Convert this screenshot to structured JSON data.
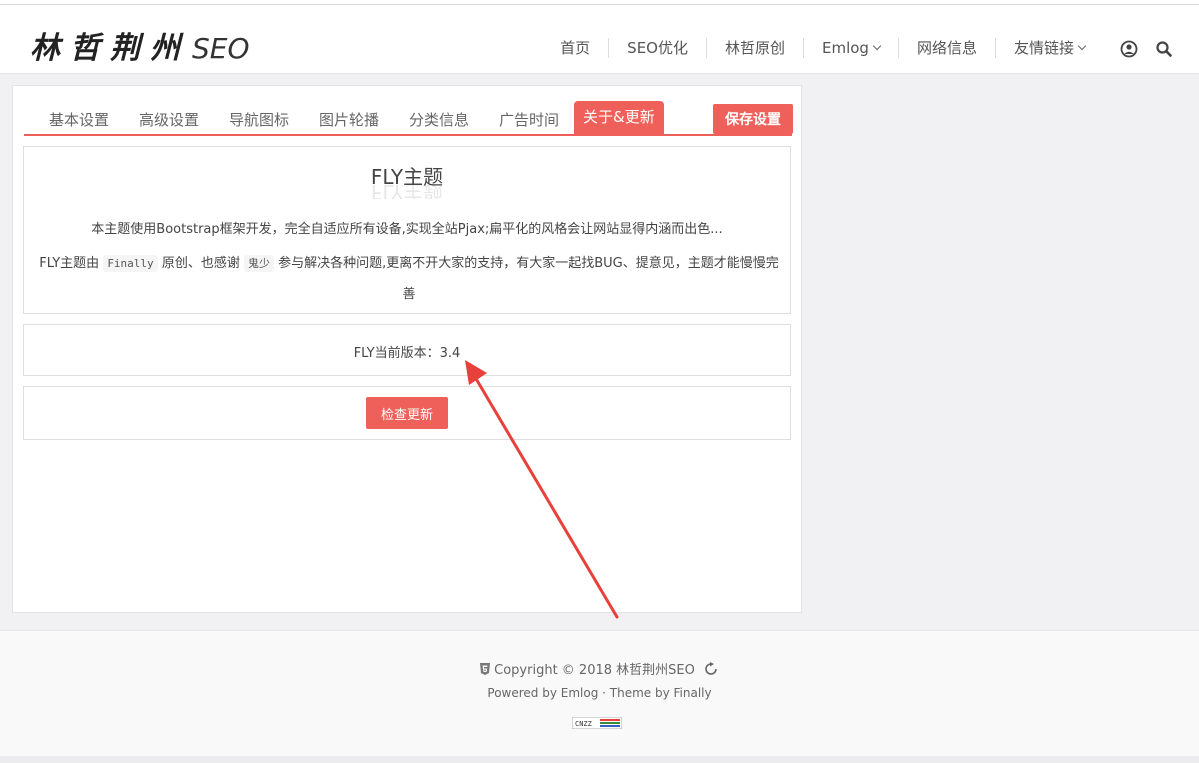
{
  "header": {
    "logo_cn": "林哲荆州",
    "logo_en": "SEO",
    "nav": [
      {
        "label": "首页",
        "dropdown": false
      },
      {
        "label": "SEO优化",
        "dropdown": false
      },
      {
        "label": "林哲原创",
        "dropdown": false
      },
      {
        "label": "Emlog",
        "dropdown": true
      },
      {
        "label": "网络信息",
        "dropdown": false
      },
      {
        "label": "友情链接",
        "dropdown": true
      }
    ],
    "icons": [
      "user-icon",
      "search-icon"
    ]
  },
  "tabs": {
    "items": [
      "基本设置",
      "高级设置",
      "导航图标",
      "图片轮播",
      "分类信息",
      "广告时间",
      "关于&更新"
    ],
    "active": "关于&更新",
    "save_label": "保存设置"
  },
  "about": {
    "title": "FLY主题",
    "desc1": "本主题使用Bootstrap框架开发，完全自适应所有设备,实现全站Pjax;扁平化的风格会让网站显得内涵而出色...",
    "desc2_a": "FLY主题由",
    "author": "Finally",
    "desc2_b": "原创、也感谢",
    "helper": "鬼少",
    "desc2_c": "参与解决各种问题,更离不开大家的支持，有大家一起找BUG、提意见，主题才能慢慢完善"
  },
  "version": {
    "text": "FLY当前版本：3.4"
  },
  "update": {
    "button_label": "检查更新"
  },
  "footer": {
    "copyright": "Copyright © 2018 林哲荆州SEO",
    "powered": "Powered by Emlog · Theme by Finally",
    "badge_text": "CNZZ"
  },
  "colors": {
    "accent": "#f0605a",
    "arrow": "#e8403a"
  }
}
